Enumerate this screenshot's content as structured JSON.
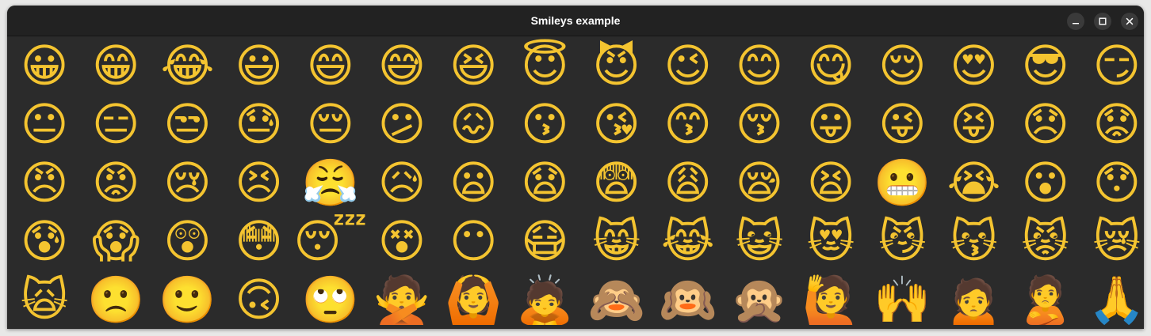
{
  "window": {
    "title": "Smileys example",
    "controls": {
      "minimize": "minimize-icon",
      "maximize": "maximize-icon",
      "close": "close-icon"
    }
  },
  "emoji_rows": [
    [
      "😀",
      "😁",
      "😂",
      "😃",
      "😄",
      "😅",
      "😆",
      "😇",
      "😈",
      "😉",
      "😊",
      "😋",
      "😌",
      "😍",
      "😎",
      "😏"
    ],
    [
      "😐",
      "😑",
      "😒",
      "😓",
      "😔",
      "😕",
      "😖",
      "😗",
      "😘",
      "😙",
      "😚",
      "😛",
      "😜",
      "😝",
      "😞",
      "😟"
    ],
    [
      "😠",
      "😡",
      "😢",
      "😣",
      "😤",
      "😥",
      "😦",
      "😧",
      "😨",
      "😩",
      "😪",
      "😫",
      "😬",
      "😭",
      "😮",
      "😯"
    ],
    [
      "😰",
      "😱",
      "😲",
      "😳",
      "😴",
      "😵",
      "😶",
      "😷",
      "😸",
      "😹",
      "😺",
      "😻",
      "😼",
      "😽",
      "😾",
      "😿"
    ],
    [
      "🙀",
      "🙁",
      "🙂",
      "🙃",
      "🙄",
      "🙅",
      "🙆",
      "🙇",
      "🙈",
      "🙉",
      "🙊",
      "🙋",
      "🙌",
      "🙍",
      "🙎",
      "🙏"
    ]
  ]
}
